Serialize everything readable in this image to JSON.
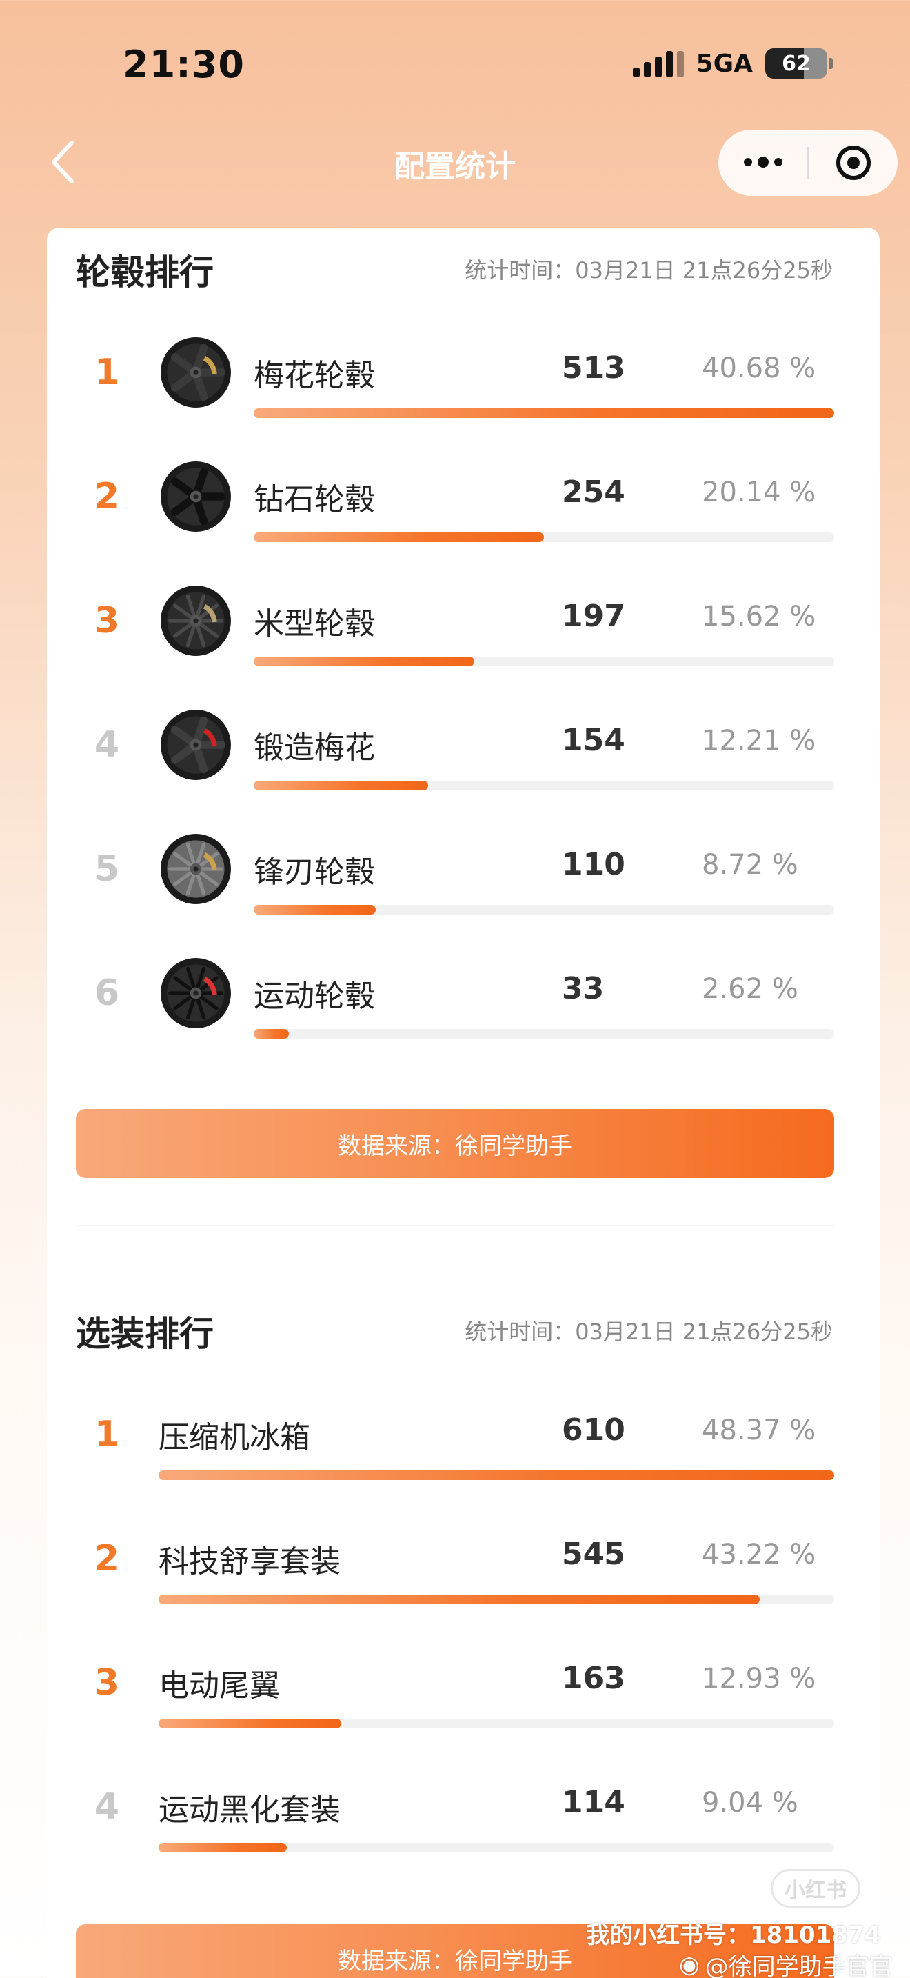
{
  "status_bar": {
    "time": "21:30",
    "network": "5GA",
    "battery": "62"
  },
  "nav": {
    "title": "配置统计"
  },
  "wheels": {
    "title": "轮毂排行",
    "stat_time": "统计时间：03月21日 21点26分25秒",
    "items": [
      {
        "rank": "1",
        "name": "梅花轮毂",
        "count": "513",
        "percent": "40.68 %",
        "bar_fraction": 1.0,
        "icon": "plum-blossom-wheel-icon"
      },
      {
        "rank": "2",
        "name": "钻石轮毂",
        "count": "254",
        "percent": "20.14 %",
        "bar_fraction": 0.5,
        "icon": "diamond-wheel-icon"
      },
      {
        "rank": "3",
        "name": "米型轮毂",
        "count": "197",
        "percent": "15.62 %",
        "bar_fraction": 0.38,
        "icon": "m-type-wheel-icon"
      },
      {
        "rank": "4",
        "name": "锻造梅花",
        "count": "154",
        "percent": "12.21 %",
        "bar_fraction": 0.3,
        "icon": "forged-plum-wheel-icon"
      },
      {
        "rank": "5",
        "name": "锋刃轮毂",
        "count": "110",
        "percent": "8.72 %",
        "bar_fraction": 0.21,
        "icon": "blade-wheel-icon"
      },
      {
        "rank": "6",
        "name": "运动轮毂",
        "count": "33",
        "percent": "2.62 %",
        "bar_fraction": 0.06,
        "icon": "sport-wheel-icon"
      }
    ],
    "source": "数据来源：徐同学助手"
  },
  "options": {
    "title": "选装排行",
    "stat_time": "统计时间：03月21日 21点26分25秒",
    "items": [
      {
        "rank": "1",
        "name": "压缩机冰箱",
        "count": "610",
        "percent": "48.37 %",
        "bar_fraction": 1.0
      },
      {
        "rank": "2",
        "name": "科技舒享套装",
        "count": "545",
        "percent": "43.22 %",
        "bar_fraction": 0.89
      },
      {
        "rank": "3",
        "name": "电动尾翼",
        "count": "163",
        "percent": "12.93 %",
        "bar_fraction": 0.27
      },
      {
        "rank": "4",
        "name": "运动黑化套装",
        "count": "114",
        "percent": "9.04 %",
        "bar_fraction": 0.19
      }
    ],
    "source": "数据来源：徐同学助手"
  },
  "watermark": {
    "logo": "小红书",
    "account": "我的小红书号：18101874",
    "weibo": "@徐同学助手官官"
  },
  "colors": {
    "accent": "#f26618",
    "rank_top": "#f07a2a",
    "rank_low": "#c8c8c8"
  }
}
